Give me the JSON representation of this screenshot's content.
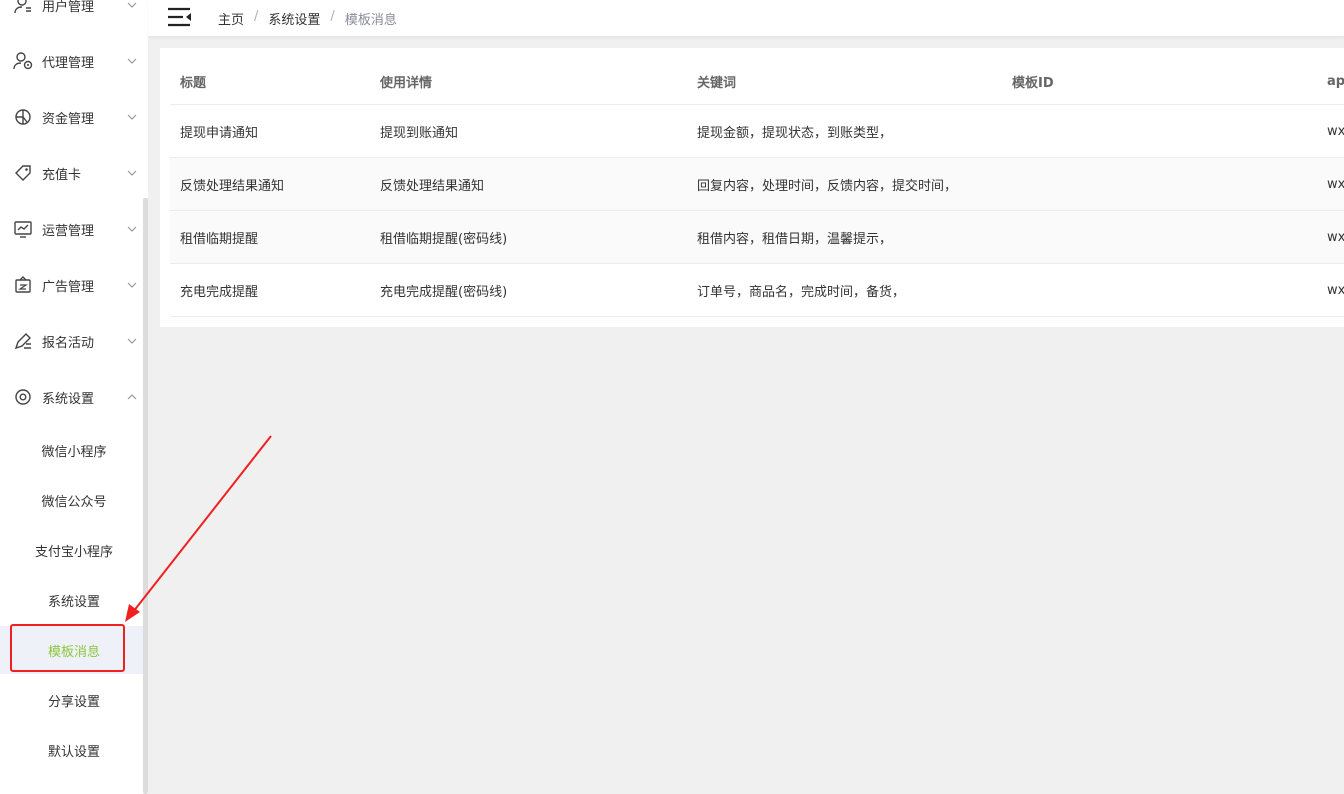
{
  "sidebar": {
    "menu": [
      {
        "label": "用户管理",
        "icon": "user-icon"
      },
      {
        "label": "代理管理",
        "icon": "agent-icon"
      },
      {
        "label": "资金管理",
        "icon": "funds-icon"
      },
      {
        "label": "充值卡",
        "icon": "tag-icon"
      },
      {
        "label": "运营管理",
        "icon": "chart-icon"
      },
      {
        "label": "广告管理",
        "icon": "ad-icon"
      },
      {
        "label": "报名活动",
        "icon": "edit-icon"
      },
      {
        "label": "系统设置",
        "icon": "gear-icon"
      }
    ],
    "submenu": [
      {
        "label": "微信小程序"
      },
      {
        "label": "微信公众号"
      },
      {
        "label": "支付宝小程序"
      },
      {
        "label": "系统设置"
      },
      {
        "label": "模板消息",
        "active": true
      },
      {
        "label": "分享设置"
      },
      {
        "label": "默认设置"
      }
    ],
    "active_color": "#8dc63f"
  },
  "breadcrumb": {
    "home": "主页",
    "section": "系统设置",
    "current": "模板消息",
    "separator": "/"
  },
  "table": {
    "headers": [
      "标题",
      "使用详情",
      "关键词",
      "模板ID",
      "ap"
    ],
    "rows": [
      {
        "title": "提现申请通知",
        "detail": "提现到账通知",
        "keywords": "提现金额，提现状态，到账类型，",
        "template_id": "",
        "app": "wx"
      },
      {
        "title": "反馈处理结果通知",
        "detail": "反馈处理结果通知",
        "keywords": "回复内容，处理时间，反馈内容，提交时间，",
        "template_id": "",
        "app": "wx"
      },
      {
        "title": "租借临期提醒",
        "detail": "租借临期提醒(密码线)",
        "keywords": "租借内容，租借日期，温馨提示，",
        "template_id": "",
        "app": "wx"
      },
      {
        "title": "充电完成提醒",
        "detail": "充电完成提醒(密码线)",
        "keywords": "订单号，商品名，完成时间，备货，",
        "template_id": "",
        "app": "wx"
      }
    ]
  },
  "annotation_color": "#f02020"
}
